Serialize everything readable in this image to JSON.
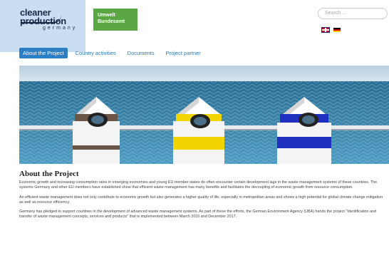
{
  "header": {
    "logo_line1": "cleaner",
    "logo_line2": "production",
    "logo_line3": "germany",
    "uba_line1": "Umwelt",
    "uba_line2": "Bundesamt",
    "search_placeholder": "Search ...",
    "languages": [
      "English",
      "Deutsch"
    ]
  },
  "nav": {
    "tabs": [
      {
        "label": "About the Project",
        "active": true
      },
      {
        "label": "Country activities",
        "active": false
      },
      {
        "label": "Documents",
        "active": false
      },
      {
        "label": "Project partner",
        "active": false
      }
    ]
  },
  "main": {
    "title": "About the Project",
    "paragraphs": [
      "Economic growth and increasing consumption rates in emerging economies and young EU member states do often encounter certain development lags in the waste management systems of these countries. The systems Germany and other EU members have established show that efficient waste management has many benefits and facilitates the decoupling of economic growth from resource consumption.",
      "An efficient waste management does not only contribute to economic growth but also generates a higher quality of life, especially in metropolitan areas and shows a high potential for global climate change mitigation as well as resource efficiency.",
      "Germany has pledged to support countries in the development of advanced waste management systems. As part of these the efforts, the German Environment Agency (UBA) hands the project \"Identification and transfer of waste management concepts, services and products\" that is implemented between March 2015 and December 2017."
    ]
  },
  "colors": {
    "accent": "#2d7fc4",
    "uba_green": "#5aa642",
    "panel": "#c9dff1"
  }
}
